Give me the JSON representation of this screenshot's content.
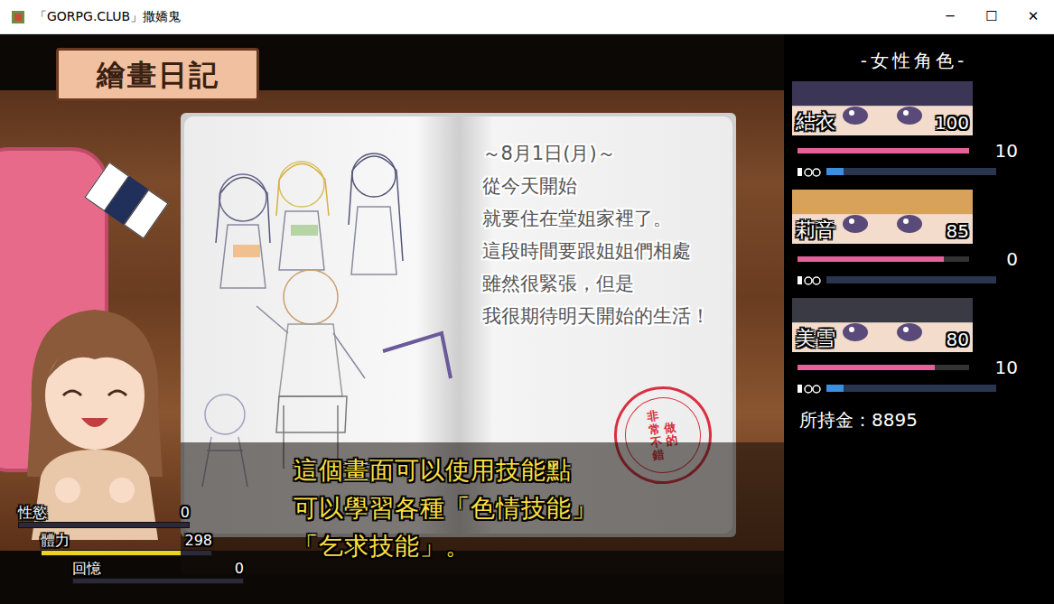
{
  "window": {
    "title": "「GORPG.CLUB」撒嬌鬼",
    "controls": [
      "─",
      "☐",
      "✕"
    ]
  },
  "scene": {
    "title": "繪畫日記"
  },
  "diary": {
    "date": "～8月1日(月)～",
    "lines": [
      "從今天開始",
      "就要住在堂姐家裡了。",
      "這段時間要跟姐姐們相處",
      "雖然很緊張，但是",
      "我很期待明天開始的生活！"
    ],
    "stamp": {
      "columns": [
        "做的",
        "非常不錯"
      ]
    }
  },
  "message": {
    "lines": [
      "這個畫面可以使用技能點",
      "可以學習各種「色情技能」",
      "「乞求技能」。"
    ]
  },
  "player": {
    "stats": [
      {
        "label": "性慾",
        "value": "0",
        "level": 0,
        "color": "#e8609a"
      },
      {
        "label": "體力",
        "value": "298",
        "level": 0.82,
        "color": "#f0d020"
      },
      {
        "label": "回憶",
        "value": "0",
        "level": 0,
        "color": "#e8609a"
      }
    ]
  },
  "heroines": {
    "header": "-女性角色-",
    "items": [
      {
        "name": "結衣",
        "affection": "100",
        "affection_level": 1,
        "lust": "10",
        "lust_level": 0.1,
        "color": "#3b3656"
      },
      {
        "name": "莉音",
        "affection": "85",
        "affection_level": 0.85,
        "lust": "0",
        "lust_level": 0,
        "color": "#d9a25a"
      },
      {
        "name": "美雪",
        "affection": "80",
        "affection_level": 0.8,
        "lust": "10",
        "lust_level": 0.1,
        "color": "#3a3a44"
      }
    ],
    "money": "所持金：8895"
  }
}
